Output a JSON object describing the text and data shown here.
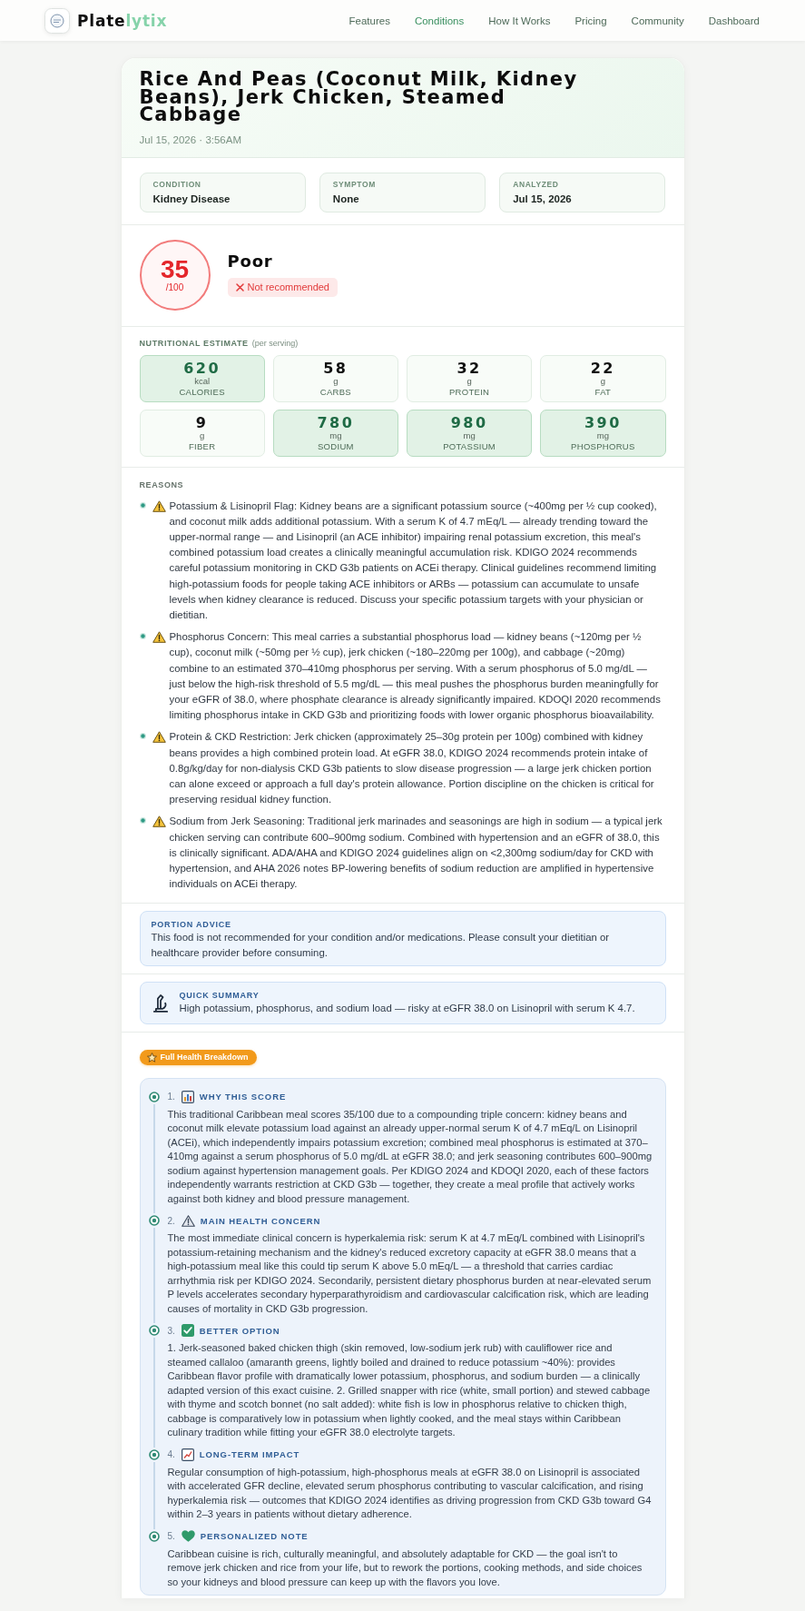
{
  "nav": {
    "brand": {
      "name": "Plate",
      "accent": "lytix"
    },
    "links": [
      {
        "label": "Features",
        "selected": false
      },
      {
        "label": "Conditions",
        "selected": true
      },
      {
        "label": "How It Works",
        "selected": false
      },
      {
        "label": "Pricing",
        "selected": false
      },
      {
        "label": "Community",
        "selected": false
      },
      {
        "label": "Dashboard",
        "selected": false
      }
    ]
  },
  "meal": {
    "title": "Rice And Peas (Coconut Milk, Kidney Beans), Jerk Chicken, Steamed Cabbage",
    "timestamp": "Jul 15, 2026 · 3:56AM"
  },
  "details": [
    {
      "label": "CONDITION",
      "value": "Kidney Disease"
    },
    {
      "label": "SYMPTOM",
      "value": "None"
    },
    {
      "label": "ANALYZED",
      "value": "Jul 15, 2026"
    }
  ],
  "score": {
    "value": "35",
    "scale": "/100",
    "rating": "Poor",
    "alert": true,
    "verdict": {
      "label": "Not recommended",
      "recommended": false
    }
  },
  "nutrition": {
    "title": "NUTRITIONAL ESTIMATE",
    "note": "(per serving)",
    "items": [
      {
        "value": "620",
        "unit": "kcal",
        "label": "CALORIES",
        "highlighted": true
      },
      {
        "value": "58",
        "unit": "g",
        "label": "CARBS",
        "highlighted": false
      },
      {
        "value": "32",
        "unit": "g",
        "label": "PROTEIN",
        "highlighted": false
      },
      {
        "value": "22",
        "unit": "g",
        "label": "FAT",
        "highlighted": false
      },
      {
        "value": "9",
        "unit": "g",
        "label": "FIBER",
        "highlighted": false
      },
      {
        "value": "780",
        "unit": "mg",
        "label": "SODIUM",
        "highlighted": true
      },
      {
        "value": "980",
        "unit": "mg",
        "label": "POTASSIUM",
        "highlighted": true
      },
      {
        "value": "390",
        "unit": "mg",
        "label": "PHOSPHORUS",
        "highlighted": true
      }
    ]
  },
  "reasons": {
    "title": "REASONS",
    "items": [
      "Potassium & Lisinopril Flag: Kidney beans are a significant potassium source (~400mg per ½ cup cooked), and coconut milk adds additional potassium. With a serum K of 4.7 mEq/L — already trending toward the upper-normal range — and Lisinopril (an ACE inhibitor) impairing renal potassium excretion, this meal's combined potassium load creates a clinically meaningful accumulation risk. KDIGO 2024 recommends careful potassium monitoring in CKD G3b patients on ACEi therapy. Clinical guidelines recommend limiting high-potassium foods for people taking ACE inhibitors or ARBs — potassium can accumulate to unsafe levels when kidney clearance is reduced. Discuss your specific potassium targets with your physician or dietitian.",
      "Phosphorus Concern: This meal carries a substantial phosphorus load — kidney beans (~120mg per ½ cup), coconut milk (~50mg per ½ cup), jerk chicken (~180–220mg per 100g), and cabbage (~20mg) combine to an estimated 370–410mg phosphorus per serving. With a serum phosphorus of 5.0 mg/dL — just below the high-risk threshold of 5.5 mg/dL — this meal pushes the phosphorus burden meaningfully for your eGFR of 38.0, where phosphate clearance is already significantly impaired. KDOQI 2020 recommends limiting phosphorus intake in CKD G3b and prioritizing foods with lower organic phosphorus bioavailability.",
      "Protein & CKD Restriction: Jerk chicken (approximately 25–30g protein per 100g) combined with kidney beans provides a high combined protein load. At eGFR 38.0, KDIGO 2024 recommends protein intake of 0.8g/kg/day for non-dialysis CKD G3b patients to slow disease progression — a large jerk chicken portion can alone exceed or approach a full day's protein allowance. Portion discipline on the chicken is critical for preserving residual kidney function.",
      "Sodium from Jerk Seasoning: Traditional jerk marinades and seasonings are high in sodium — a typical jerk chicken serving can contribute 600–900mg sodium. Combined with hypertension and an eGFR of 38.0, this is clinically significant. ADA/AHA and KDIGO 2024 guidelines align on <2,300mg sodium/day for CKD with hypertension, and AHA 2026 notes BP-lowering benefits of sodium reduction are amplified in hypertensive individuals on ACEi therapy."
    ]
  },
  "portion_advice": {
    "title": "PORTION ADVICE",
    "text": "This food is not recommended for your condition and/or medications. Please consult your dietitian or healthcare provider before consuming."
  },
  "quick_summary": {
    "title": "QUICK SUMMARY",
    "text": "High potassium, phosphorus, and sodium load — risky at eGFR 38.0 on Lisinopril with serum K 4.7."
  },
  "breakdown": {
    "badge": "Full Health Breakdown",
    "sections": [
      {
        "number": "1.",
        "kind": "score",
        "title": "WHY THIS SCORE",
        "text": "This traditional Caribbean meal scores 35/100 due to a compounding triple concern: kidney beans and coconut milk elevate potassium load against an already upper-normal serum K of 4.7 mEq/L on Lisinopril (ACEi), which independently impairs potassium excretion; combined meal phosphorus is estimated at 370–410mg against a serum phosphorus of 5.0 mg/dL at eGFR 38.0; and jerk seasoning contributes 600–900mg sodium against hypertension management goals. Per KDIGO 2024 and KDOQI 2020, each of these factors independently warrants restriction at CKD G3b — together, they create a meal profile that actively works against both kidney and blood pressure management."
      },
      {
        "number": "2.",
        "kind": "concern",
        "title": "MAIN HEALTH CONCERN",
        "text": "The most immediate clinical concern is hyperkalemia risk: serum K at 4.7 mEq/L combined with Lisinopril's potassium-retaining mechanism and the kidney's reduced excretory capacity at eGFR 38.0 means that a high-potassium meal like this could tip serum K above 5.0 mEq/L — a threshold that carries cardiac arrhythmia risk per KDIGO 2024. Secondarily, persistent dietary phosphorus burden at near-elevated serum P levels accelerates secondary hyperparathyroidism and cardiovascular calcification risk, which are leading causes of mortality in CKD G3b progression."
      },
      {
        "number": "3.",
        "kind": "option",
        "title": "BETTER OPTION",
        "text": "1. Jerk-seasoned baked chicken thigh (skin removed, low-sodium jerk rub) with cauliflower rice and steamed callaloo (amaranth greens, lightly boiled and drained to reduce potassium ~40%): provides Caribbean flavor profile with dramatically lower potassium, phosphorus, and sodium burden — a clinically adapted version of this exact cuisine. 2. Grilled snapper with rice (white, small portion) and stewed cabbage with thyme and scotch bonnet (no salt added): white fish is low in phosphorus relative to chicken thigh, cabbage is comparatively low in potassium when lightly cooked, and the meal stays within Caribbean culinary tradition while fitting your eGFR 38.0 electrolyte targets."
      },
      {
        "number": "4.",
        "kind": "impact",
        "title": "LONG-TERM IMPACT",
        "text": "Regular consumption of high-potassium, high-phosphorus meals at eGFR 38.0 on Lisinopril is associated with accelerated GFR decline, elevated serum phosphorus contributing to vascular calcification, and rising hyperkalemia risk — outcomes that KDIGO 2024 identifies as driving progression from CKD G3b toward G4 within 2–3 years in patients without dietary adherence."
      },
      {
        "number": "5.",
        "kind": "note",
        "title": "PERSONALIZED NOTE",
        "text": "Caribbean cuisine is rich, culturally meaningful, and absolutely adaptable for CKD — the goal isn't to remove jerk chicken and rice from your life, but to rework the portions, cooking methods, and side choices so your kidneys and blood pressure can keep up with the flavors you love."
      }
    ]
  }
}
